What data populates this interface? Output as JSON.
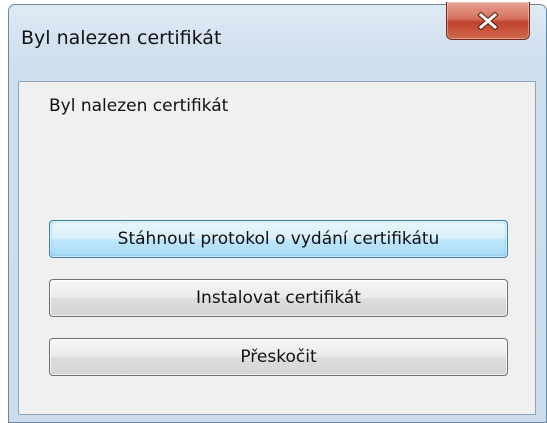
{
  "window": {
    "title": "Byl nalezen certifikát"
  },
  "dialog": {
    "message": "Byl nalezen certifikát",
    "buttons": {
      "download_label": "Stáhnout protokol o vydání certifikátu",
      "install_label": "Instalovat certifikát",
      "skip_label": "Přeskočit"
    }
  },
  "icons": {
    "close": "close-x-icon"
  },
  "colors": {
    "close_button": "#c94a33",
    "default_button_border": "#3c7fb1",
    "window_frame": "#cfdfee",
    "client_background": "#f0f0f0"
  }
}
